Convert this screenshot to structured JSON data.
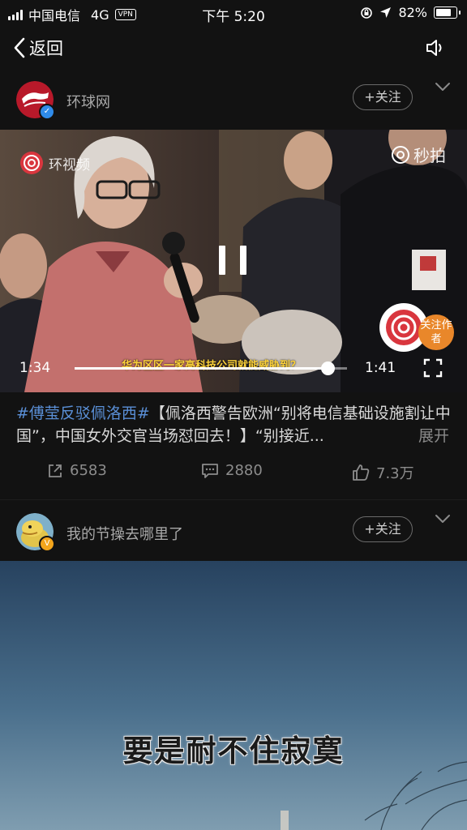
{
  "status_bar": {
    "carrier": "中国电信",
    "network": "4G",
    "vpn": "VPN",
    "time": "下午 5:20",
    "battery": "82%",
    "battery_level": 0.82
  },
  "nav": {
    "back_label": "返回"
  },
  "post1": {
    "username": "环球网",
    "follow_label": "+关注",
    "video": {
      "watermark": "环视频",
      "miaopai": "秒拍",
      "subtitle": "华为区区一家高科技公司就能威胁到？",
      "current_time": "1:34",
      "duration": "1:41",
      "progress": 0.93,
      "author_follow": "关注作者"
    },
    "caption": {
      "hashtag": "#傅莹反驳佩洛西#",
      "text": "【佩洛西警告欧洲“别将电信基础设施割让中国”，中国女外交官当场怼回去！】“别接近...",
      "expand": "展开"
    },
    "actions": {
      "share": "6583",
      "comment": "2880",
      "like": "7.3万"
    }
  },
  "post2": {
    "username": "我的节操去哪里了",
    "follow_label": "+关注",
    "subtitle": "要是耐不住寂寞"
  },
  "colors": {
    "background": "#121212",
    "hashtag": "#5a8fd6",
    "verified_blue": "#2f8bea",
    "verified_gold": "#f3a51c",
    "follow_author": "#e9872a"
  }
}
